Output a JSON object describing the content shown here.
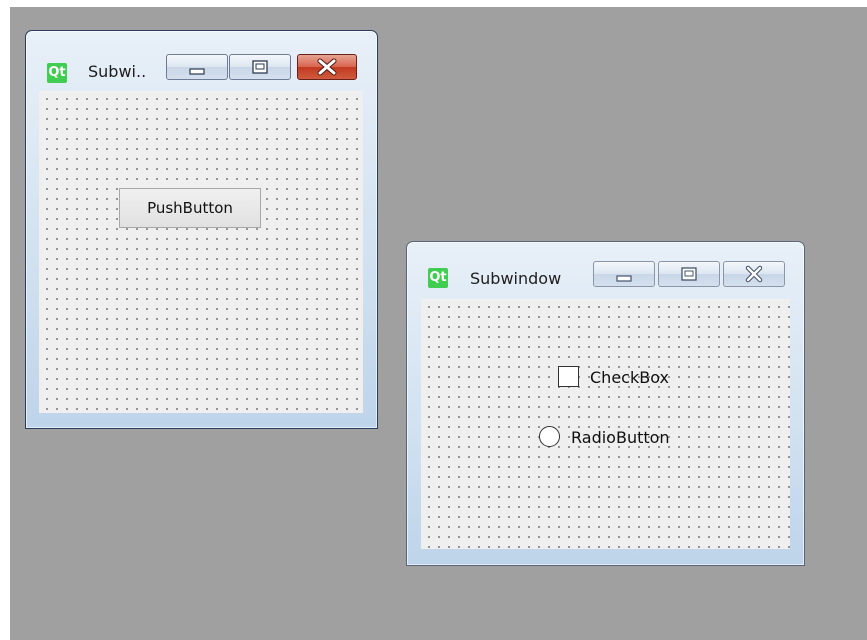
{
  "window1": {
    "title": "Subwi..",
    "logo": "Qt",
    "push_button_label": "PushButton",
    "controls": [
      "minimize-icon",
      "restore-icon",
      "close-icon"
    ]
  },
  "window2": {
    "title": "Subwindow",
    "logo": "Qt",
    "checkbox_label": "CheckBox",
    "radio_label": "RadioButton",
    "controls": [
      "minimize-icon",
      "restore-icon",
      "close-icon"
    ]
  },
  "colors": {
    "mdi_background": "#a0a0a0",
    "qt_logo": "#41cd52",
    "close_active": "#c23a22"
  }
}
